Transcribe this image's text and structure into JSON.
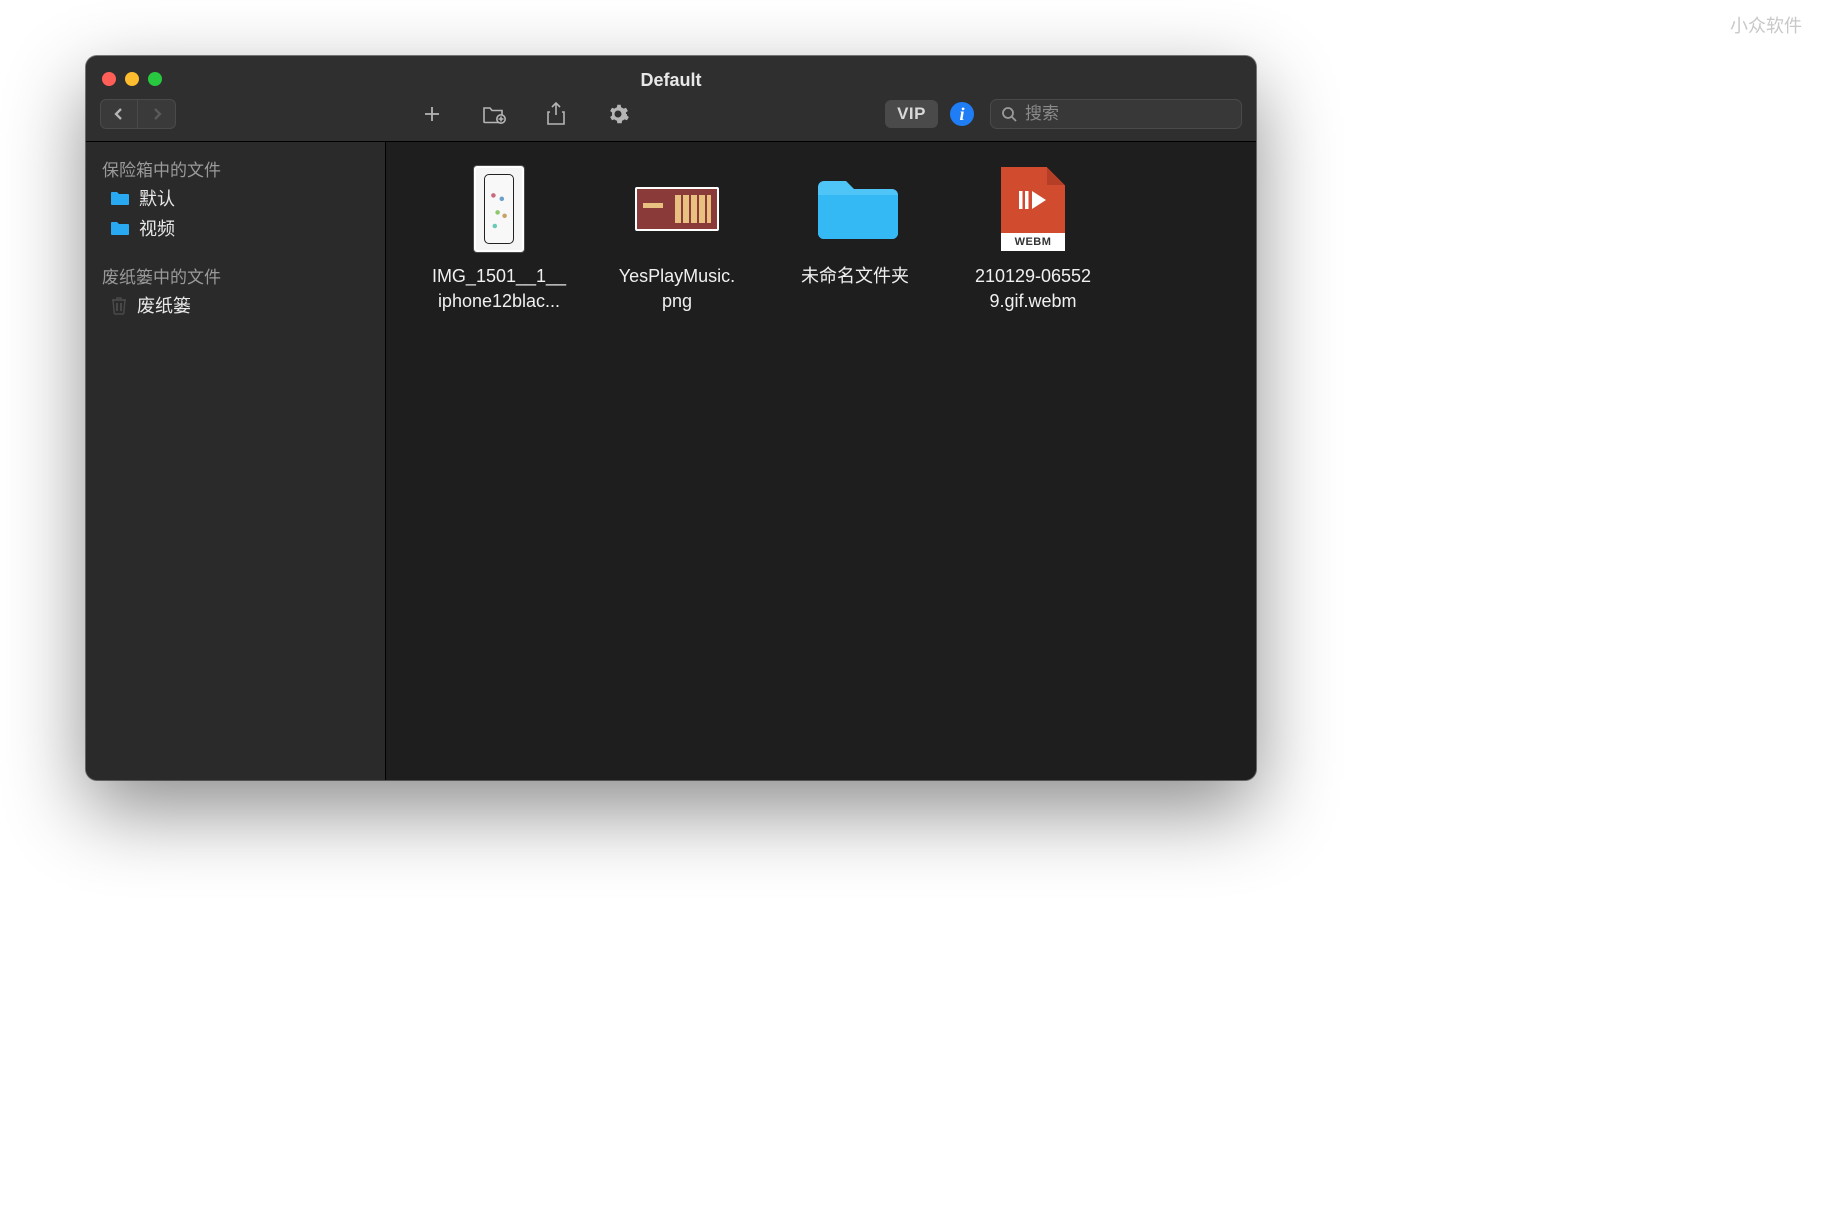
{
  "watermark": "小众软件",
  "window": {
    "title": "Default"
  },
  "toolbar": {
    "vip_label": "VIP",
    "info_glyph": "i"
  },
  "search": {
    "placeholder": "搜索"
  },
  "sidebar": {
    "sections": [
      {
        "header": "保险箱中的文件",
        "items": [
          {
            "label": "默认",
            "icon": "folder"
          },
          {
            "label": "视频",
            "icon": "folder"
          }
        ]
      },
      {
        "header": "废纸篓中的文件",
        "items": [
          {
            "label": "废纸篓",
            "icon": "trash"
          }
        ]
      }
    ]
  },
  "files": [
    {
      "name": "IMG_1501__1__\niphone12blac...",
      "type": "image-phone"
    },
    {
      "name": "YesPlayMusic.\npng",
      "type": "image"
    },
    {
      "name": "未命名文件夹",
      "type": "folder"
    },
    {
      "name": "210129-06552\n9.gif.webm",
      "type": "webm",
      "badge": "WEBM"
    }
  ]
}
